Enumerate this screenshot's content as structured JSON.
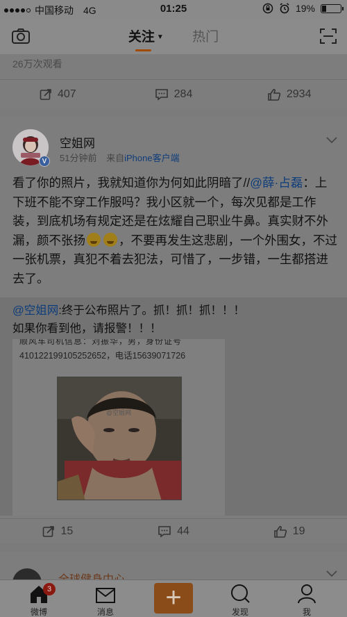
{
  "status_bar": {
    "carrier": "中国移动",
    "network": "4G",
    "time": "01:25",
    "battery": "19%"
  },
  "nav": {
    "tab_follow": "关注",
    "tab_hot": "热门"
  },
  "prev_post": {
    "views": "26万次观看",
    "reposts": "407",
    "comments": "284",
    "likes": "2934"
  },
  "post": {
    "username": "空姐网",
    "time": "51分钟前",
    "source_prefix": "来自",
    "source_app": "iPhone客户端",
    "text_before": "看了你的照片，我就知道你为何如此阴暗了//",
    "mention": "@薛·占磊",
    "text_after": "：上下班不能不穿工作服吗？我小区就一个，每次见都是工作装，到底机场有规定还是在炫耀自己职业牛鼻。真实财不外漏，颜不张扬",
    "text_end": "，不要再发生这悲剧，一个外围女，不过一张机票，真犯不着去犯法，可惜了，一步错，一生都搭进去了。",
    "repost": {
      "mention": "@空姐网",
      "line1": ":终于公布照片了。抓！抓！抓！！！",
      "line2": "如果你看到他，请报警！！！",
      "image_caption1": "顺风车司机信息：刘振华，男，身份证号",
      "image_caption2": "410122199105252652，电话15639071726",
      "watermark": "@空姐网"
    },
    "reposts": "15",
    "comments": "44",
    "likes": "19"
  },
  "next_post": {
    "username": "全球健身中心"
  },
  "tab_bar": {
    "home": "微博",
    "home_badge": "3",
    "messages": "消息",
    "compose": "+",
    "discover": "发现",
    "me": "我"
  }
}
